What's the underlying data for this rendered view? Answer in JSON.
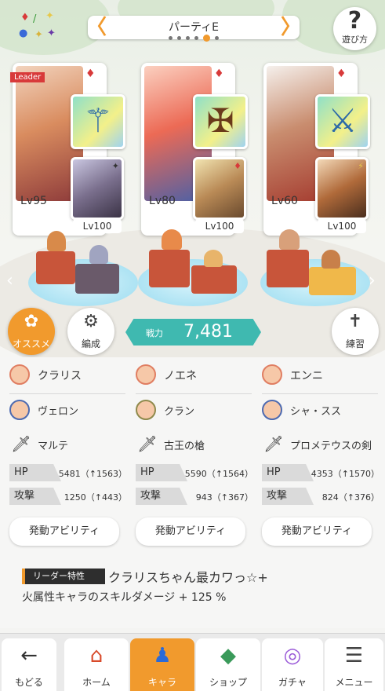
{
  "header": {
    "party_title": "パーティE",
    "prev_arrow": "〈",
    "next_arrow": "〉",
    "help_icon": "?",
    "help_label": "遊び方"
  },
  "element_icons": [
    "♦",
    "/",
    "✦",
    "●",
    "✦",
    "✦"
  ],
  "cards": [
    {
      "leader_label": "Leader",
      "suit": "♦",
      "main_level": "Lv95",
      "sub_level": "Lv100",
      "sub_mark": "✦"
    },
    {
      "suit": "♦",
      "main_level": "Lv80",
      "sub_level": "Lv100",
      "sub_mark": "♦"
    },
    {
      "suit": "♦",
      "main_level": "Lv60",
      "sub_level": "Lv100",
      "sub_mark": "⚡"
    }
  ],
  "buttons": {
    "recommend_label": "オススメ",
    "formation_label": "編成",
    "practice_label": "練習",
    "power_label": "戦力",
    "power_value": "7,481"
  },
  "columns": [
    {
      "main_name": "クラリス",
      "sub_name": "ヴェロン",
      "weapon": "マルテ",
      "hp_label": "HP",
      "hp_value": "5481（↑1563）",
      "atk_label": "攻撃",
      "atk_value": "1250（↑443）",
      "ability_label": "発動アビリティ"
    },
    {
      "main_name": "ノエネ",
      "sub_name": "クラン",
      "weapon": "古王の槍",
      "hp_label": "HP",
      "hp_value": "5590（↑1564）",
      "atk_label": "攻撃",
      "atk_value": "943（↑367）",
      "ability_label": "発動アビリティ"
    },
    {
      "main_name": "エンニ",
      "sub_name": "シャ・スス",
      "weapon": "プロメテウスの剣",
      "hp_label": "HP",
      "hp_value": "4353（↑1570）",
      "atk_label": "攻撃",
      "atk_value": "824（↑376）",
      "ability_label": "発動アビリティ"
    }
  ],
  "leader_skill": {
    "tag": "リーダー特性",
    "name": "クラリスちゃん最カワっ☆+",
    "description": "火属性キャラのスキルダメージ + 125 %"
  },
  "nav": [
    {
      "label": "もどる",
      "icon": "←"
    },
    {
      "label": "ホーム",
      "icon": "⌂"
    },
    {
      "label": "キャラ",
      "icon": "♟",
      "active": true
    },
    {
      "label": "ショップ",
      "icon": "◆"
    },
    {
      "label": "ガチャ",
      "icon": "◎"
    },
    {
      "label": "メニュー",
      "icon": "☰"
    }
  ],
  "colors": {
    "accent": "#f19a2d",
    "teal": "#3fb9b0",
    "suit_red": "#d83a3a"
  }
}
